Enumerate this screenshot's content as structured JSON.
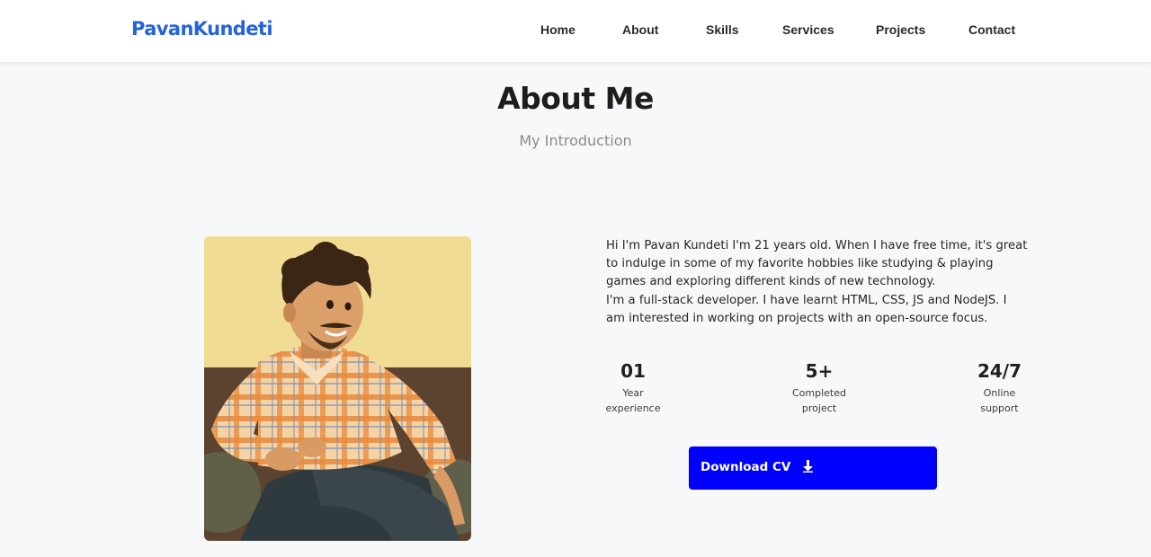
{
  "header": {
    "logo": "PavanKundeti",
    "nav": [
      "Home",
      "About",
      "Skills",
      "Services",
      "Projects",
      "Contact"
    ]
  },
  "section": {
    "title": "About Me",
    "subtitle": "My Introduction"
  },
  "about": {
    "paragraph_1": "Hi I'm Pavan Kundeti I'm 21 years old. When I have free time, it's great to indulge in some of my favorite hobbies like studying & playing games and exploring different kinds of new technology.",
    "paragraph_2": "I'm a full-stack developer. I have learnt HTML, CSS, JS and NodeJS. I am interested in working on projects with an open-source focus.",
    "stats": [
      {
        "value": "01",
        "label_line1": "Year",
        "label_line2": "experience"
      },
      {
        "value": "5+",
        "label_line1": "Completed",
        "label_line2": "project"
      },
      {
        "value": "24/7",
        "label_line1": "Online",
        "label_line2": "support"
      }
    ],
    "button_label": "Download CV",
    "button_icon": "download-arrow-icon"
  },
  "colors": {
    "brand": "#2563d9",
    "button": "#0000ff",
    "background": "#f7f8fa"
  }
}
